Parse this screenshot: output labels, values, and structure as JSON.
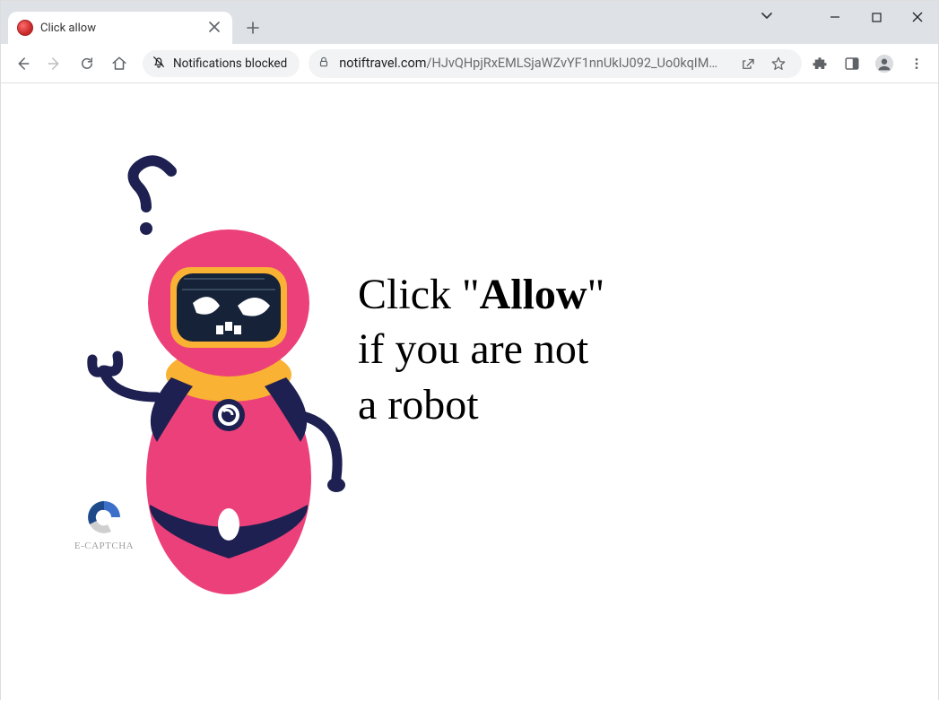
{
  "window": {
    "tab_title": "Click allow"
  },
  "toolbar": {
    "notifications_chip": "Notifications blocked",
    "url_domain": "notiftravel.com",
    "url_path": "/HJvQHpjRxEMLSjaWZvYF1nnUkIJ092_Uo0kqIMS..."
  },
  "page": {
    "msg_prefix": "Click \"",
    "msg_bold": "Allow",
    "msg_suffix": "\"",
    "msg_line2": "if you are not",
    "msg_line3": "a robot",
    "captcha_label": "E-CAPTCHA"
  }
}
